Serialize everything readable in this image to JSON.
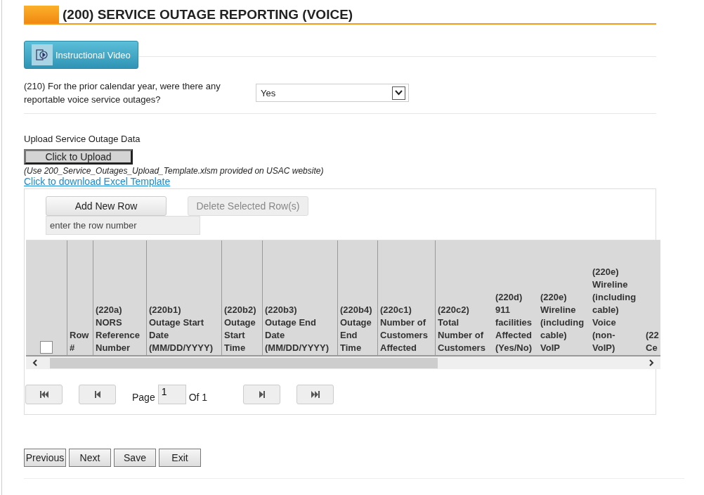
{
  "section": {
    "title": "(200) SERVICE OUTAGE REPORTING (VOICE)"
  },
  "video_button": {
    "label": "Instructional Video"
  },
  "question": {
    "text": "(210) For the prior calendar year, were there any reportable voice service outages?",
    "value": "Yes"
  },
  "upload": {
    "label": "Upload Service Outage Data",
    "button": "Click to Upload",
    "note": "(Use 200_Service_Outages_Upload_Template.xlsm provided on USAC website)",
    "link": "Click to download Excel Template"
  },
  "grid": {
    "add_button": "Add New Row",
    "delete_button": {
      "label": "Delete Selected Row(s)",
      "disabled": true
    },
    "row_input": {
      "placeholder": "enter the row number"
    },
    "select_all": {
      "checked": false
    },
    "columns": [
      {
        "lines": [
          "Row",
          "#"
        ]
      },
      {
        "lines": [
          "(220a)",
          "NORS",
          "Reference",
          "Number"
        ]
      },
      {
        "lines": [
          "(220b1)",
          "Outage Start",
          "Date",
          "(MM/DD/YYYY)"
        ]
      },
      {
        "lines": [
          "(220b2)",
          "Outage",
          "Start",
          "Time"
        ]
      },
      {
        "lines": [
          "(220b3)",
          "Outage End",
          "Date",
          "(MM/DD/YYYY)"
        ]
      },
      {
        "lines": [
          "(220b4)",
          "Outage",
          "End",
          "Time"
        ]
      },
      {
        "lines": [
          "(220c1)",
          "Number of",
          "Customers",
          "Affected"
        ]
      },
      {
        "lines": [
          "(220c2)",
          "Total",
          "Number of",
          "Customers"
        ]
      },
      {
        "lines": [
          "(220d)",
          "911",
          "facilities",
          "Affected",
          "(Yes/No)"
        ]
      },
      {
        "lines": [
          "(220e)",
          "Wireline",
          "(including",
          "cable)",
          "VoIP"
        ]
      },
      {
        "lines": [
          "(220e)",
          "Wireline",
          "(including",
          "cable)",
          "Voice",
          "(non-",
          "VoIP)"
        ]
      },
      {
        "lines": [
          "(22",
          "Ce"
        ]
      }
    ],
    "pager": {
      "page_label": "Page",
      "page": "1",
      "of_label": "Of 1"
    }
  },
  "nav_buttons": [
    "Previous",
    "Next",
    "Save",
    "Exit"
  ]
}
